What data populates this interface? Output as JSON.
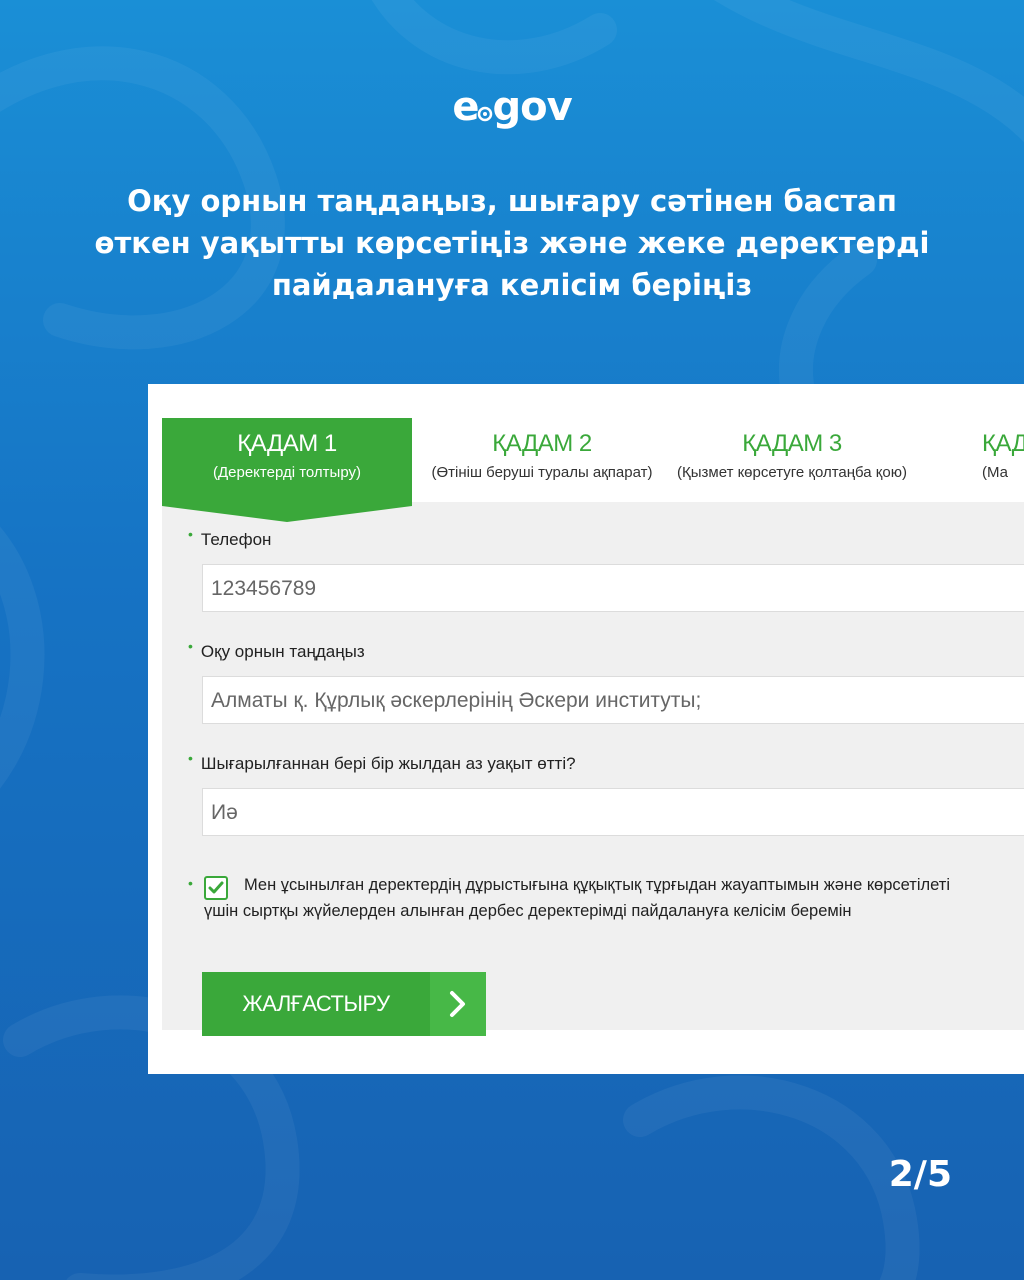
{
  "brand": {
    "logo_left": "e",
    "logo_right": "gov"
  },
  "headline": [
    "Оқу орнын таңдаңыз, шығару сәтінен бастап",
    "өткен уақытты көрсетіңіз және жеке деректерді",
    "пайдалануға келісім беріңіз"
  ],
  "steps": [
    {
      "title": "ҚАДАМ 1",
      "subtitle": "(Деректерді толтыру)",
      "active": true
    },
    {
      "title": "ҚАДАМ 2",
      "subtitle": "(Өтініш беруші туралы ақпарат)",
      "active": false
    },
    {
      "title": "ҚАДАМ 3",
      "subtitle": "(Қызмет көрсетуге қолтаңба қою)",
      "active": false
    },
    {
      "title": "ҚАД",
      "subtitle": "(Ма",
      "active": false
    }
  ],
  "form": {
    "phone_label": "Телефон",
    "phone_value": "123456789",
    "school_label": "Оқу орнын таңдаңыз",
    "school_value": "Алматы қ. Құрлық әскерлерінің Әскери институты;",
    "year_label": "Шығарылғаннан бері бір жылдан аз уақыт өтті?",
    "year_value": "Иә",
    "consent_line1": "Мен ұсынылған деректердің дұрыстығына құқықтық тұрғыдан жауаптымын және көрсетілеті",
    "consent_line2": "үшін сыртқы жүйелерден алынған дербес деректерімді пайдалануға келісім беремін",
    "consent_checked": true,
    "continue_label": "ЖАЛҒАСТЫРУ"
  },
  "pager": "2/5",
  "colors": {
    "accent_green": "#3aa83a",
    "background_blue": "#1a7fd0"
  }
}
